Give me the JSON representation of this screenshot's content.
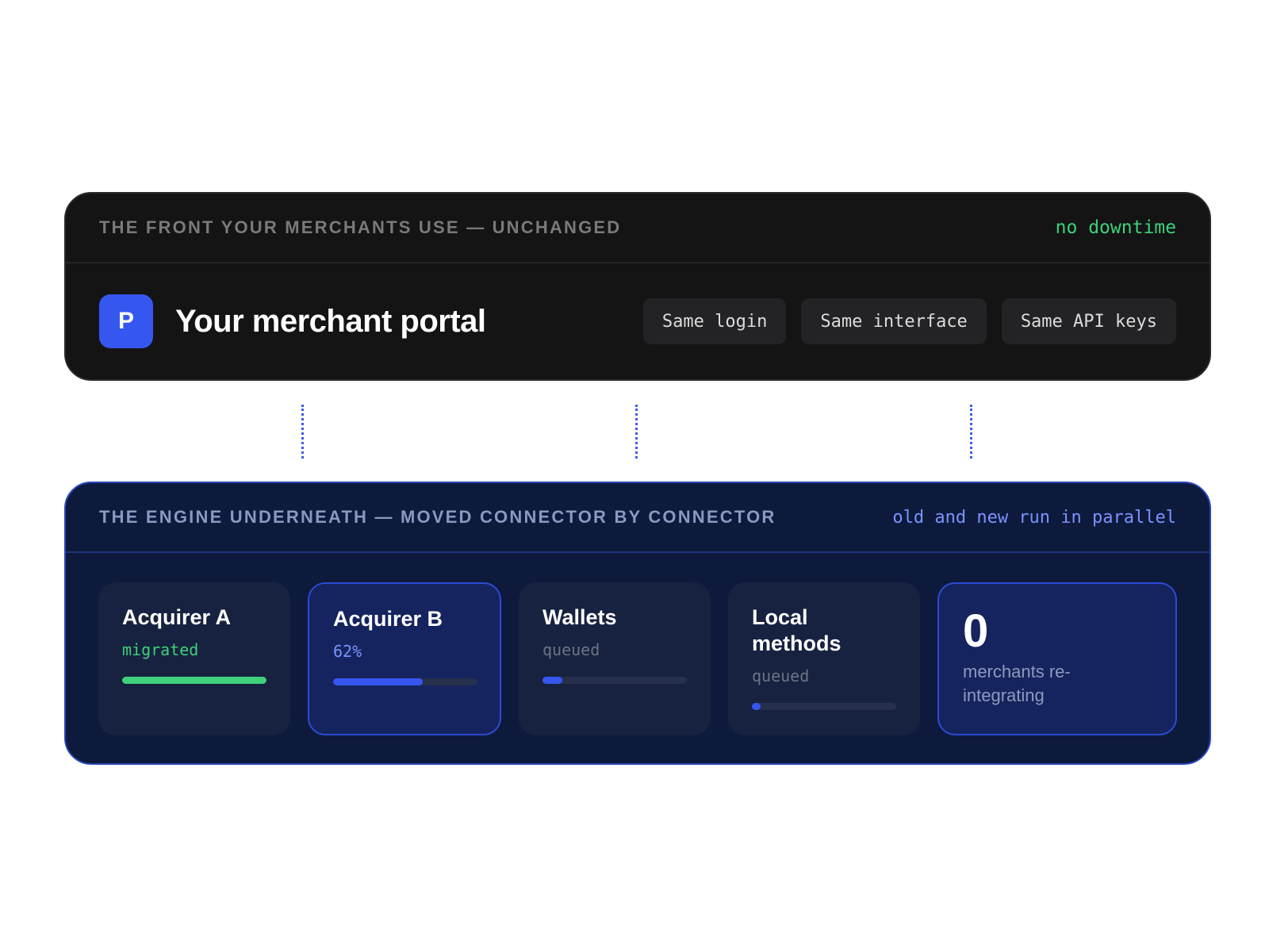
{
  "front": {
    "eyebrow": "THE FRONT YOUR MERCHANTS USE — UNCHANGED",
    "status": "no downtime",
    "logo_letter": "P",
    "title": "Your merchant portal",
    "chips": [
      "Same login",
      "Same interface",
      "Same API keys"
    ]
  },
  "engine": {
    "eyebrow": "THE ENGINE UNDERNEATH — MOVED CONNECTOR BY CONNECTOR",
    "status": "old and new run in parallel",
    "connectors": [
      {
        "name": "Acquirer A",
        "status": "migrated",
        "progress": 1.0
      },
      {
        "name": "Acquirer B",
        "status": "62%",
        "progress": 0.62
      },
      {
        "name": "Wallets",
        "status": "queued",
        "progress": 0.14
      },
      {
        "name": "Local methods",
        "status": "queued",
        "progress": 0.06
      }
    ],
    "stat": {
      "value": "0",
      "label": "merchants re-integrating"
    }
  },
  "colors": {
    "accent": "#3557f0",
    "success": "#3fd17a",
    "engine_bg": "#0d1a3c",
    "front_bg": "#141414"
  }
}
